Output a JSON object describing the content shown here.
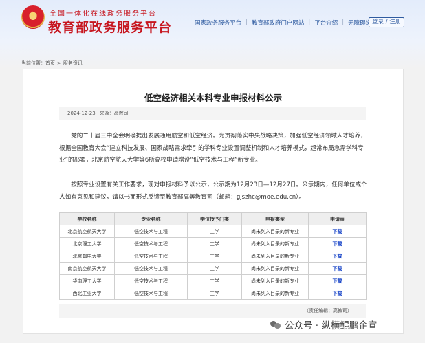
{
  "header": {
    "site_subtitle": "全国一体化在线政务服务平台",
    "site_title": "教育部政务服务平台",
    "nav": [
      "国家政务服务平台",
      "教育部政府门户网站",
      "平台介绍",
      "无障碍浏览"
    ],
    "login_label": "登录 / 注册"
  },
  "breadcrumb": {
    "prefix": "当前位置：",
    "home": "首页",
    "separator": ">",
    "current": "服务资讯"
  },
  "article": {
    "title": "低空经济相关本科专业申报材料公示",
    "date": "2024-12-23",
    "source": "来源：高教司",
    "paragraphs": [
      "党的二十届三中全会明确提出发展通用航空和低空经济。为贯彻落实中央战略决策，加强低空经济领域人才培养，根据全国教育大会“建立科技发展、国家战略需求牵引的学科专业设置调整机制和人才培养模式，超常布局急需学科专业”的部署，北京航空航天大学等6所高校申请增设“低空技术与工程”新专业。",
      "按照专业设置有关工作要求，现对申报材料予以公示，公示期为12月23日—12月27日。公示期内，任何单位或个人如有意见和建议，请以书面形式反馈至教育部高等教育司（邮箱：gjszhc@moe.edu.cn）。"
    ],
    "table": {
      "headers": [
        "学校名称",
        "专业名称",
        "学位授予门类",
        "申报类型",
        "申请表"
      ],
      "rows": [
        [
          "北京航空航天大学",
          "低空技术与工程",
          "工学",
          "尚未列入目录的新专业",
          "下载"
        ],
        [
          "北京理工大学",
          "低空技术与工程",
          "工学",
          "尚未列入目录的新专业",
          "下载"
        ],
        [
          "北京邮电大学",
          "低空技术与工程",
          "工学",
          "尚未列入目录的新专业",
          "下载"
        ],
        [
          "南京航空航天大学",
          "低空技术与工程",
          "工学",
          "尚未列入目录的新专业",
          "下载"
        ],
        [
          "华南理工大学",
          "低空技术与工程",
          "工学",
          "尚未列入目录的新专业",
          "下载"
        ],
        [
          "西北工业大学",
          "低空技术与工程",
          "工学",
          "尚未列入目录的新专业",
          "下载"
        ]
      ]
    },
    "editor": "（责任编辑：高教司）"
  },
  "watermark": "公众号 · 纵横鲲鹏企宣",
  "colors": {
    "brand_red": "#c7161f",
    "nav_blue": "#2f5ba0",
    "download_blue": "#1a46c8"
  },
  "icons": {
    "emblem": "national-emblem-icon",
    "watermark": "wechat-icon"
  }
}
